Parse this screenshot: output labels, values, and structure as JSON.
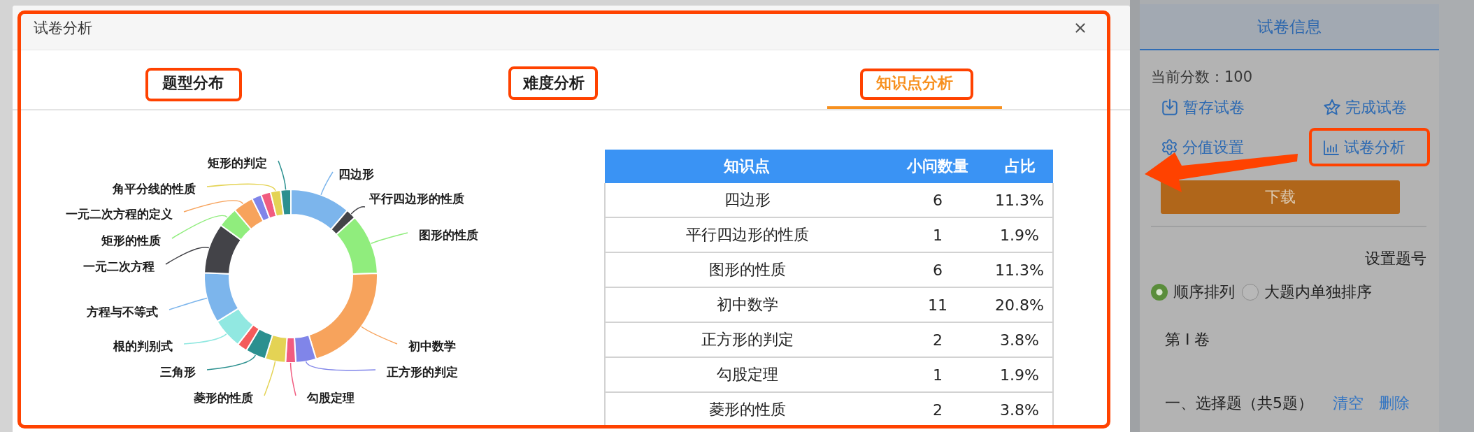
{
  "dialog": {
    "title": "试卷分析"
  },
  "tabs": [
    {
      "label": "题型分布",
      "selected": false
    },
    {
      "label": "难度分析",
      "selected": false
    },
    {
      "label": "知识点分析",
      "selected": true
    }
  ],
  "knowledge_chart": {
    "chart_data": {
      "type": "donut",
      "categories": [
        "四边形",
        "平行四边形的性质",
        "图形的性质",
        "初中数学",
        "正方形的判定",
        "勾股定理",
        "菱形的性质",
        "三角形",
        null,
        "根的判别式",
        "方程与不等式",
        "一元二次方程",
        "矩形的性质",
        "一元二次方程的定义",
        null,
        null,
        "角平分线的性质",
        "矩形的判定"
      ],
      "values": [
        11.3,
        1.9,
        11.3,
        20.8,
        3.8,
        1.9,
        3.8,
        3.8,
        1.9,
        5.7,
        9.4,
        9.4,
        3.8,
        3.8,
        1.8,
        1.8,
        1.9,
        1.9
      ]
    }
  },
  "table": {
    "columns": [
      "知识点",
      "小问数量",
      "占比"
    ],
    "rows": [
      [
        "四边形",
        "6",
        "11.3%"
      ],
      [
        "平行四边形的性质",
        "1",
        "1.9%"
      ],
      [
        "图形的性质",
        "6",
        "11.3%"
      ],
      [
        "初中数学",
        "11",
        "20.8%"
      ],
      [
        "正方形的判定",
        "2",
        "3.8%"
      ],
      [
        "勾股定理",
        "1",
        "1.9%"
      ],
      [
        "菱形的性质",
        "2",
        "3.8%"
      ]
    ]
  },
  "side_panel": {
    "title": "试卷信息",
    "score": "当前分数：100",
    "actions": [
      {
        "kind": "save",
        "label": "暂存试卷"
      },
      {
        "kind": "finish",
        "label": "完成试卷"
      },
      {
        "kind": "settings",
        "label": "分值设置"
      },
      {
        "kind": "analysis",
        "label": "试卷分析"
      }
    ],
    "download_button": "下载",
    "numbering_title": "设置题号",
    "numbering_options": [
      {
        "label": "顺序排列",
        "selected": true
      },
      {
        "label": "大题内单独排序",
        "selected": false
      }
    ],
    "volume_title": "第 I 卷",
    "section": {
      "title": "一、选择题（共5题）",
      "links": [
        "清空",
        "删除"
      ]
    }
  }
}
